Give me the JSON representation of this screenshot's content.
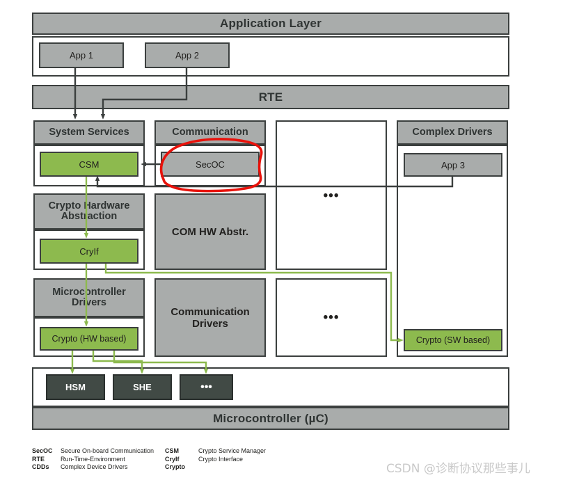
{
  "diagram": {
    "title_bands": {
      "application_layer": "Application Layer",
      "rte": "RTE",
      "microcontroller": "Microcontroller (µC)"
    },
    "apps": [
      {
        "label": "App 1"
      },
      {
        "label": "App 2"
      }
    ],
    "columns": [
      {
        "id": "system-services",
        "header": "System Services",
        "blocks": [
          {
            "label": "CSM",
            "style": "green"
          }
        ]
      },
      {
        "id": "communication",
        "header": "Communication",
        "blocks": [
          {
            "label": "SecOC",
            "style": "gray",
            "annotated": true
          }
        ]
      },
      {
        "id": "placeholder-upper",
        "header": "",
        "blocks": []
      },
      {
        "id": "complex-drivers",
        "header": "Complex Drivers",
        "blocks": [
          {
            "label": "App 3",
            "style": "gray"
          },
          {
            "label": "Crypto (SW based)",
            "style": "green"
          }
        ]
      }
    ],
    "row2": {
      "crypto_hw_abstraction": "Crypto Hardware Abstraction",
      "cryif": "CryIf",
      "com_hw_abstr": "COM HW Abstr.",
      "ellipsis": "•••"
    },
    "row3": {
      "microcontroller_drivers": "Microcontroller Drivers",
      "crypto_hw_based": "Crypto (HW based)",
      "communication_drivers": "Communication Drivers",
      "ellipsis": "•••"
    },
    "hardware_modules": [
      {
        "label": "HSM"
      },
      {
        "label": "SHE"
      },
      {
        "label": "•••"
      }
    ],
    "colors": {
      "green": "#8dba4e",
      "gray": "#a9acab",
      "dark": "#414a45",
      "outline": "#3b3f3e",
      "annotation": "#e8120b"
    }
  },
  "legend": {
    "left": [
      {
        "abbr": "SecOC",
        "text": "Secure On-board Communication"
      },
      {
        "abbr": "RTE",
        "text": "Run-Time-Environment"
      },
      {
        "abbr": "CDDs",
        "text": "Complex Device Drivers"
      }
    ],
    "right": [
      {
        "abbr": "CSM",
        "text": "Crypto Service Manager"
      },
      {
        "abbr": "CryIf",
        "text": "Crypto Interface"
      },
      {
        "abbr": "Crypto",
        "text": ""
      }
    ]
  },
  "watermark": {
    "text": "CSDN @诊断协议那些事儿"
  }
}
